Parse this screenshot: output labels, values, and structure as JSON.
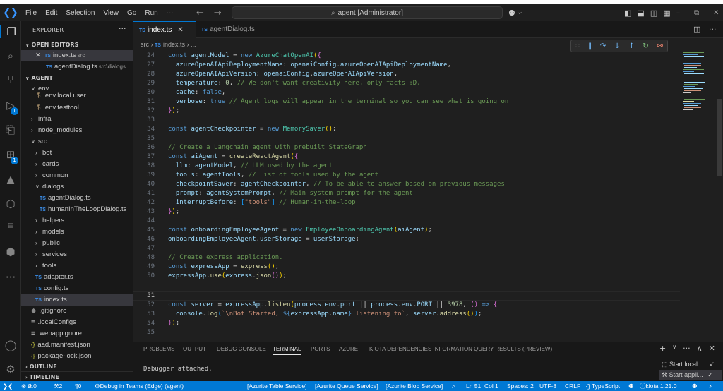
{
  "titlebar": {
    "menu": [
      "File",
      "Edit",
      "Selection",
      "View",
      "Go",
      "Run",
      "···"
    ],
    "search_text": "agent [Administrator]"
  },
  "explorer": {
    "title": "EXPLORER",
    "open_editors_header": "OPEN EDITORS",
    "open_editors": [
      {
        "name": "index.ts",
        "path": "src"
      },
      {
        "name": "agentDialog.ts",
        "path": "src\\dialogs"
      }
    ],
    "workspace_header": "AGENT",
    "tree": {
      "env": "env",
      "env_local_user": ".env.local.user",
      "env_testtool": ".env.testtool",
      "infra": "infra",
      "node_modules": "node_modules",
      "src": "src",
      "bot": "bot",
      "cards": "cards",
      "common": "common",
      "dialogs": "dialogs",
      "agentDialog": "agentDialog.ts",
      "humanInTheLoopDialog": "humanInTheLoopDialog.ts",
      "helpers": "helpers",
      "models": "models",
      "public": "public",
      "services": "services",
      "tools": "tools",
      "adapter": "adapter.ts",
      "config": "config.ts",
      "index": "index.ts",
      "gitignore": ".gitignore",
      "localConfigs": ".localConfigs",
      "webappignore": ".webappignore",
      "aad_manifest": "aad.manifest.json",
      "package_lock": "package-lock.json"
    },
    "outline_header": "OUTLINE",
    "timeline_header": "TIMELINE"
  },
  "tabs": [
    {
      "label": "index.ts",
      "active": true
    },
    {
      "label": "agentDialog.ts",
      "active": false
    }
  ],
  "breadcrumb": {
    "folder": "src",
    "file": "index.ts",
    "more": "..."
  },
  "editor": {
    "line_numbers": [
      "24",
      "27",
      "28",
      "29",
      "30",
      "31",
      "32",
      "33",
      "34",
      "35",
      "36",
      "37",
      "38",
      "39",
      "40",
      "41",
      "42",
      "43",
      "44",
      "45",
      "46",
      "47",
      "48",
      "49",
      "50",
      "51",
      "52",
      "53",
      "54",
      "55"
    ],
    "current_line": "51"
  },
  "panel": {
    "tabs": [
      "PROBLEMS",
      "OUTPUT",
      "DEBUG CONSOLE",
      "TERMINAL",
      "PORTS",
      "AZURE",
      "KIOTA DEPENDENCIES INFORMATION",
      "QUERY RESULTS (PREVIEW)"
    ],
    "active_tab": "TERMINAL",
    "terminal_output": "Debugger attached.",
    "terminals": [
      "Start local ...",
      "Start appli..."
    ]
  },
  "statusbar": {
    "errors": "0",
    "warnings": "0",
    "ports": "2",
    "info": "0",
    "debug": "Debug in Teams (Edge) (agent)",
    "azurite_table": "[Azurite Table Service]",
    "azurite_queue": "[Azurite Queue Service]",
    "azurite_blob": "[Azurite Blob Service]",
    "position": "Ln 51, Col 1",
    "spaces": "Spaces: 2",
    "encoding": "UTF-8",
    "eol": "CRLF",
    "language": "{} TypeScript",
    "kiota": "kiota 1.21.0"
  },
  "colors": {
    "accent": "#0078d4",
    "editor_bg": "#1f1f1f",
    "sidebar_bg": "#181818"
  },
  "icons": [
    "vscode-logo-icon",
    "files-icon",
    "search-icon",
    "source-control-icon",
    "run-debug-icon",
    "remote-explorer-icon",
    "extensions-icon",
    "azure-icon",
    "teams-toolkit-icon",
    "docker-icon",
    "more-icon",
    "account-icon",
    "settings-gear-icon"
  ]
}
